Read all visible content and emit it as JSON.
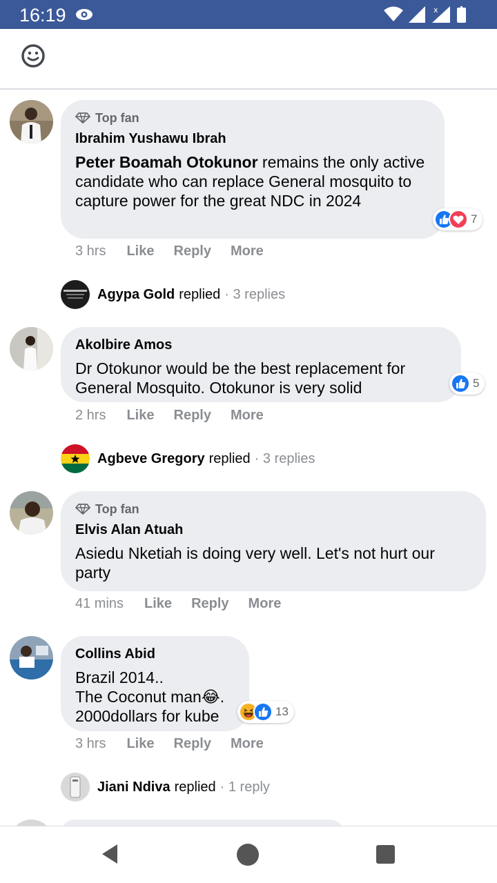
{
  "status_bar": {
    "time": "16:19"
  },
  "comments": [
    {
      "top_fan": "Top fan",
      "author": "Ibrahim Yushawu Ibrah",
      "text_bold": "Peter Boamah Otokunor",
      "text": " remains the only active candidate who can replace General mosquito to capture power for the great NDC in 2024",
      "time": "3 hrs",
      "like": "Like",
      "reply": "Reply",
      "more": "More",
      "reactions": [
        "like",
        "love"
      ],
      "reaction_count": "7",
      "replies": {
        "name": "Agypa Gold",
        "verb": "replied",
        "count": "· 3 replies"
      }
    },
    {
      "author": "Akolbire Amos",
      "text": "Dr Otokunor would be the best replacement for General Mosquito. Otokunor is very solid",
      "time": "2 hrs",
      "like": "Like",
      "reply": "Reply",
      "more": "More",
      "reactions": [
        "like"
      ],
      "reaction_count": "5",
      "replies": {
        "name": "Agbeve Gregory",
        "verb": "replied",
        "count": "· 3 replies"
      }
    },
    {
      "top_fan": "Top fan",
      "author": "Elvis Alan Atuah",
      "text": "Asiedu Nketiah is doing very well. Let's not hurt our party",
      "time": "41 mins",
      "like": "Like",
      "reply": "Reply",
      "more": "More"
    },
    {
      "author": "Collins Abid",
      "text_line1": "Brazil 2014..",
      "text_line2": "The Coconut man",
      "text_line2_emoji": "😂",
      "text_line2_end": ".",
      "text_line3": "2000dollars for kube",
      "time": "3 hrs",
      "like": "Like",
      "reply": "Reply",
      "more": "More",
      "reactions": [
        "haha",
        "like"
      ],
      "reaction_count": "13",
      "replies": {
        "name": "Jiani Ndiva",
        "verb": "replied",
        "count": "· 1 reply"
      }
    }
  ],
  "icons": {
    "emoji": "smiley-icon",
    "top_fan": "diamond-icon",
    "like": "like-reaction-icon",
    "love": "love-reaction-icon",
    "haha": "haha-reaction-icon"
  },
  "colors": {
    "status_bar": "#3b5998",
    "bubble": "#ebedf0",
    "like_blue": "#1877f2",
    "love_red": "#f33e58",
    "muted": "#8a8d91"
  }
}
